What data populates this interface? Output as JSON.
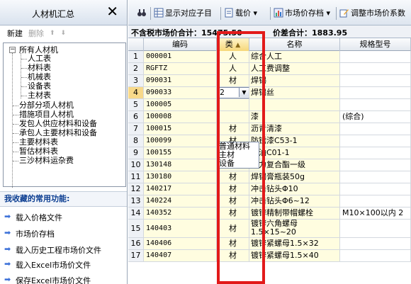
{
  "left_panel": {
    "title": "人材机汇总",
    "close_glyph": "✕",
    "new_label": "新建",
    "delete_label": "删除",
    "tree": [
      "所有人材机",
      "人工表",
      "材料表",
      "机械表",
      "设备表",
      "主材表",
      "分部分项人材机",
      "措施项目人材机",
      "发包人供应材料和设备",
      "承包人主要材料和设备",
      "主要材料表",
      "暂估材料表",
      "三沙材料运杂费"
    ],
    "favorites_title": "我收藏的常用功能:",
    "favorites": [
      "载入价格文件",
      "市场价存档",
      "载入历史工程市场价文件",
      "载入Excel市场价文件",
      "保存Excel市场价文件"
    ]
  },
  "toolbar": {
    "show_sub": "显示对应子目",
    "price": "载价",
    "market_archive": "市场价存档",
    "adjust": "调整市场价系数"
  },
  "summary": {
    "excl_total": "不含税市场价合计：15475.50",
    "diff_total": "价差合计：1883.95"
  },
  "grid": {
    "headers": {
      "no": "",
      "code": "编码",
      "type": "类",
      "sort_arrow": "▲",
      "name": "名称",
      "spec": "规格型号"
    },
    "rows": [
      {
        "n": "1",
        "code": "000001",
        "type": "人",
        "name": "综合人工",
        "spec": ""
      },
      {
        "n": "2",
        "code": "RGFTZ",
        "type": "人",
        "name": "人工费调整",
        "spec": ""
      },
      {
        "n": "3",
        "code": "090031",
        "type": "材",
        "name": "焊锡",
        "spec": ""
      },
      {
        "n": "4",
        "code": "090033",
        "type": "2",
        "name": "焊锡丝",
        "spec": ""
      },
      {
        "n": "5",
        "code": "100005",
        "type": "",
        "name": "",
        "spec": ""
      },
      {
        "n": "6",
        "code": "100008",
        "type": "",
        "name": "漆",
        "spec": "(综合)"
      },
      {
        "n": "7",
        "code": "100015",
        "type": "材",
        "name": "沥青清漆",
        "spec": ""
      },
      {
        "n": "8",
        "code": "100099",
        "type": "材",
        "name": "防锈漆C53-1",
        "spec": ""
      },
      {
        "n": "9",
        "code": "100155",
        "type": "材",
        "name": "清油C01-1",
        "spec": ""
      },
      {
        "n": "10",
        "code": "130148",
        "type": "材",
        "name": "电力复合酯一级",
        "spec": ""
      },
      {
        "n": "11",
        "code": "130180",
        "type": "材",
        "name": "焊锡膏瓶装50g",
        "spec": ""
      },
      {
        "n": "12",
        "code": "140217",
        "type": "材",
        "name": "冲击钻头Φ10",
        "spec": ""
      },
      {
        "n": "13",
        "code": "140224",
        "type": "材",
        "name": "冲击钻头Φ6~12",
        "spec": ""
      },
      {
        "n": "14",
        "code": "140352",
        "type": "材",
        "name": "镀锌精制带帽螺栓",
        "spec": "M10×100以内 2"
      },
      {
        "n": "15",
        "code": "140403",
        "type": "材",
        "name": "镀锌六角螺母1.5×15~20",
        "spec": ""
      },
      {
        "n": "16",
        "code": "140406",
        "type": "材",
        "name": "镀锌紧螺母1.5×32",
        "spec": ""
      },
      {
        "n": "17",
        "code": "140407",
        "type": "材",
        "name": "镀锌紧螺母1.5×40",
        "spec": ""
      }
    ],
    "dropdown_options": [
      "普通材料",
      "主材",
      "设备"
    ]
  }
}
